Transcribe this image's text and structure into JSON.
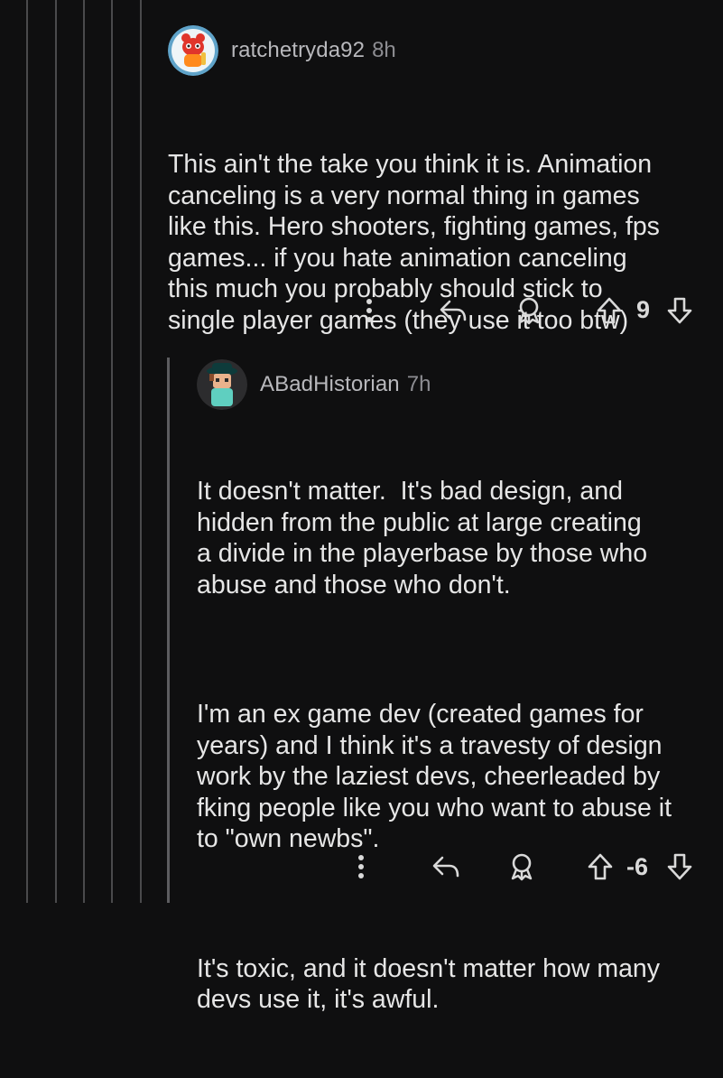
{
  "comments": [
    {
      "username": "ratchetryda92",
      "time": "8h",
      "body": [
        "This ain't the take you think it is. Animation\ncanceling is a very normal thing in games\nlike this. Hero shooters, fighting games, fps\ngames... if you hate animation canceling\nthis much you probably should stick to\nsingle player games (they use it too btw)"
      ],
      "score": "9",
      "avatar_icon": "snoo-avatar-icon"
    },
    {
      "username": "ABadHistorian",
      "time": "7h",
      "body": [
        "It doesn't matter.  It's bad design, and\nhidden from the public at large creating\na divide in the playerbase by those who\nabuse and those who don't.",
        "I'm an ex game dev (created games for\nyears) and I think it's a travesty of design\nwork by the laziest devs, cheerleaded by\nfking people like you who want to abuse it\nto \"own newbs\".",
        "It's toxic, and it doesn't matter how many\ndevs use it, it's awful."
      ],
      "score": "-6",
      "avatar_icon": "snoo-avatar-icon"
    }
  ],
  "colors": {
    "background": "#0f0f10",
    "text": "#e6e6e6",
    "muted": "#8d8d92",
    "thread_line": "#4a4a4c"
  },
  "icons": [
    "more-options-icon",
    "reply-icon",
    "award-icon",
    "upvote-icon",
    "downvote-icon"
  ]
}
